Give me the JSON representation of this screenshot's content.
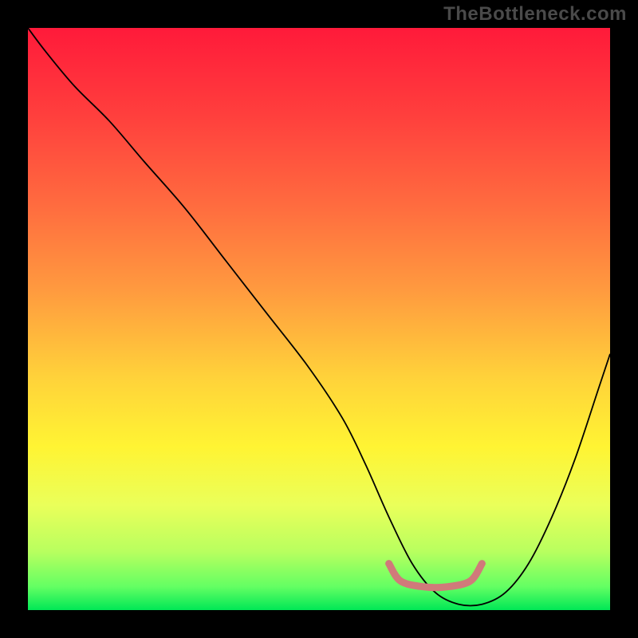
{
  "watermark": "TheBottleneck.com",
  "chart_data": {
    "type": "line",
    "title": "",
    "xlabel": "",
    "ylabel": "",
    "xlim": [
      0,
      100
    ],
    "ylim": [
      0,
      100
    ],
    "grid": false,
    "annotations": [],
    "gradient_stops": [
      {
        "offset": 0.0,
        "color": "#ff1a3a"
      },
      {
        "offset": 0.15,
        "color": "#ff3f3d"
      },
      {
        "offset": 0.3,
        "color": "#ff6a3f"
      },
      {
        "offset": 0.45,
        "color": "#ff9a3f"
      },
      {
        "offset": 0.6,
        "color": "#ffd23a"
      },
      {
        "offset": 0.72,
        "color": "#fff433"
      },
      {
        "offset": 0.82,
        "color": "#eaff5a"
      },
      {
        "offset": 0.9,
        "color": "#b8ff5f"
      },
      {
        "offset": 0.96,
        "color": "#63ff63"
      },
      {
        "offset": 1.0,
        "color": "#00e756"
      }
    ],
    "series": [
      {
        "name": "curve",
        "color": "#000000",
        "x": [
          0,
          3,
          8,
          14,
          20,
          27,
          34,
          41,
          48,
          54,
          58,
          62,
          66,
          70,
          74,
          78,
          82,
          86,
          90,
          94,
          98,
          100
        ],
        "y": [
          100,
          96,
          90,
          84,
          77,
          69,
          60,
          51,
          42,
          33,
          25,
          16,
          8,
          3,
          1,
          1,
          3,
          8,
          16,
          26,
          38,
          44
        ]
      }
    ],
    "highlight_band": {
      "name": "optimal-band",
      "color": "#d07a7a",
      "x": [
        62,
        64,
        68,
        72,
        76,
        78
      ],
      "y": [
        8,
        5,
        4,
        4,
        5,
        8
      ]
    }
  }
}
